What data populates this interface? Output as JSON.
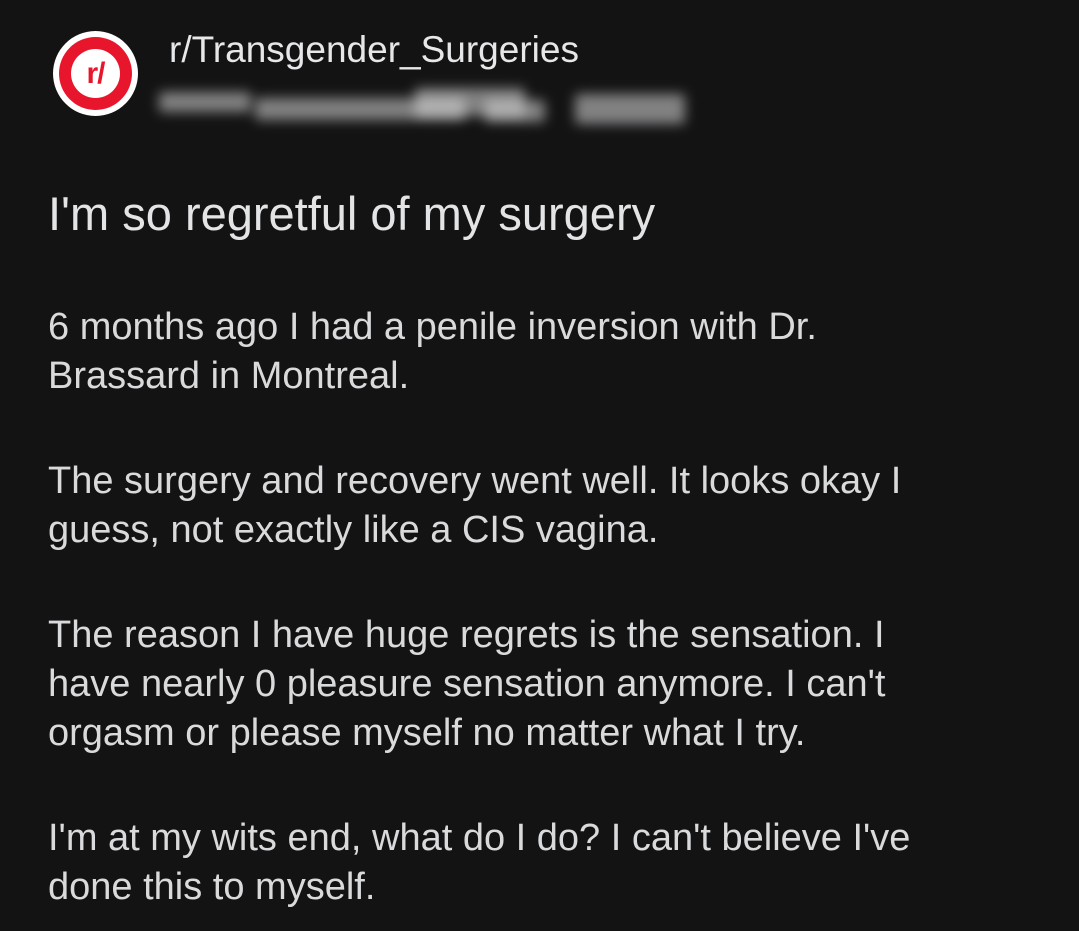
{
  "post": {
    "subreddit": "r/Transgender_Surgeries",
    "avatar_label": "r/",
    "title": "I'm so regretful of my surgery",
    "paragraphs": [
      {
        "lines": [
          "6 months ago I had a penile inversion with Dr.",
          "Brassard in Montreal."
        ]
      },
      {
        "lines": [
          "The surgery and recovery went well. It looks okay I",
          "guess, not exactly like a CIS vagina."
        ]
      },
      {
        "lines": [
          "The reason I have huge regrets is the sensation. I",
          "have nearly 0 pleasure sensation anymore. I can't",
          "orgasm or please myself no matter what I try."
        ]
      },
      {
        "lines": [
          "I'm at my wits end, what do I do? I can't believe I've",
          "done this to myself."
        ]
      }
    ]
  },
  "colors": {
    "background": "#131314",
    "text": "#d9dadc",
    "reddit_red": "#e8162d"
  },
  "icons": {
    "subreddit_avatar": "subreddit-logo-icon"
  }
}
